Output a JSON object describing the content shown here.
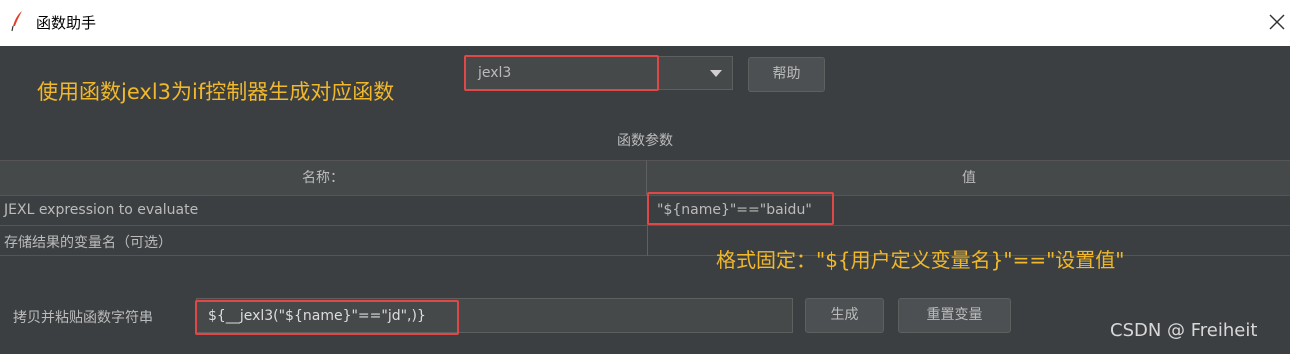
{
  "window": {
    "title": "函数助手",
    "close_symbol": "✕"
  },
  "annotations": {
    "top": "使用函数jexl3为if控制器生成对应函数",
    "format": "格式固定：\"${用户定义变量名}\"==\"设置值\""
  },
  "function_select": {
    "value": "jexl3"
  },
  "help_button": {
    "label": "帮助"
  },
  "params": {
    "title": "函数参数",
    "headers": {
      "name": "名称：",
      "value": "值"
    },
    "rows": [
      {
        "name": "JEXL expression to evaluate",
        "value": "\"${name}\"==\"baidu\""
      },
      {
        "name": "存储结果的变量名（可选）",
        "value": ""
      }
    ]
  },
  "result": {
    "label": "拷贝并粘贴函数字符串",
    "value": "${__jexl3(\"${name}\"==\"jd\",)}"
  },
  "generate_button": {
    "label": "生成"
  },
  "reset_button": {
    "label": "重置变量"
  },
  "watermark": "CSDN @ Freiheit",
  "colors": {
    "background": "#3c3f41",
    "annotation": "#f0b82a",
    "highlight_box": "#e04848"
  }
}
